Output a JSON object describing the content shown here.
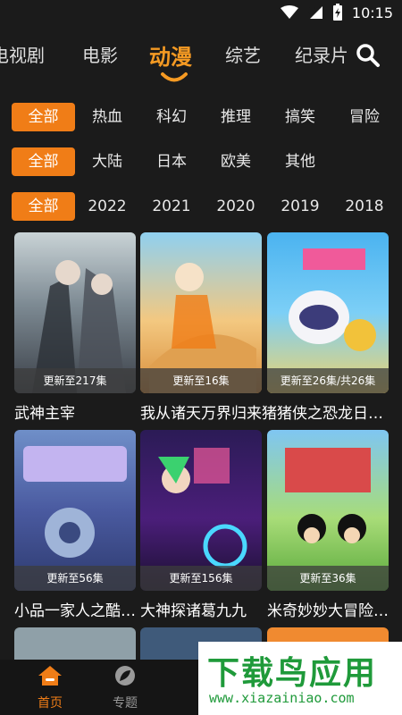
{
  "status_bar": {
    "time": "10:15"
  },
  "top_tabs": [
    "电视剧",
    "电影",
    "动漫",
    "综艺",
    "纪录片"
  ],
  "filters": {
    "genre": [
      "全部",
      "热血",
      "科幻",
      "推理",
      "搞笑",
      "冒险"
    ],
    "region": [
      "全部",
      "大陆",
      "日本",
      "欧美",
      "其他"
    ],
    "year": [
      "全部",
      "2022",
      "2021",
      "2020",
      "2019",
      "2018"
    ]
  },
  "cards": [
    {
      "title": "武神主宰",
      "badge": "更新至217集"
    },
    {
      "title": "我从诸天万界归来猪猪侠之恐龙日…",
      "badge": "更新至16集"
    },
    {
      "title": "",
      "badge": "更新至26集/共26集"
    },
    {
      "title": "小品一家人之酷…",
      "badge": "更新至56集"
    },
    {
      "title": "大神探诸葛九九",
      "badge": "更新至156集"
    },
    {
      "title": "米奇妙妙大冒险 …",
      "badge": "更新至36集"
    }
  ],
  "bottom_nav": [
    {
      "label": "首页",
      "active": true
    },
    {
      "label": "专题",
      "active": false
    }
  ],
  "watermark": {
    "big": "下载鸟应用",
    "small": "www.xiazainiao.com"
  },
  "colors": {
    "accent": "#f07d17",
    "background": "#1b1b1b"
  }
}
